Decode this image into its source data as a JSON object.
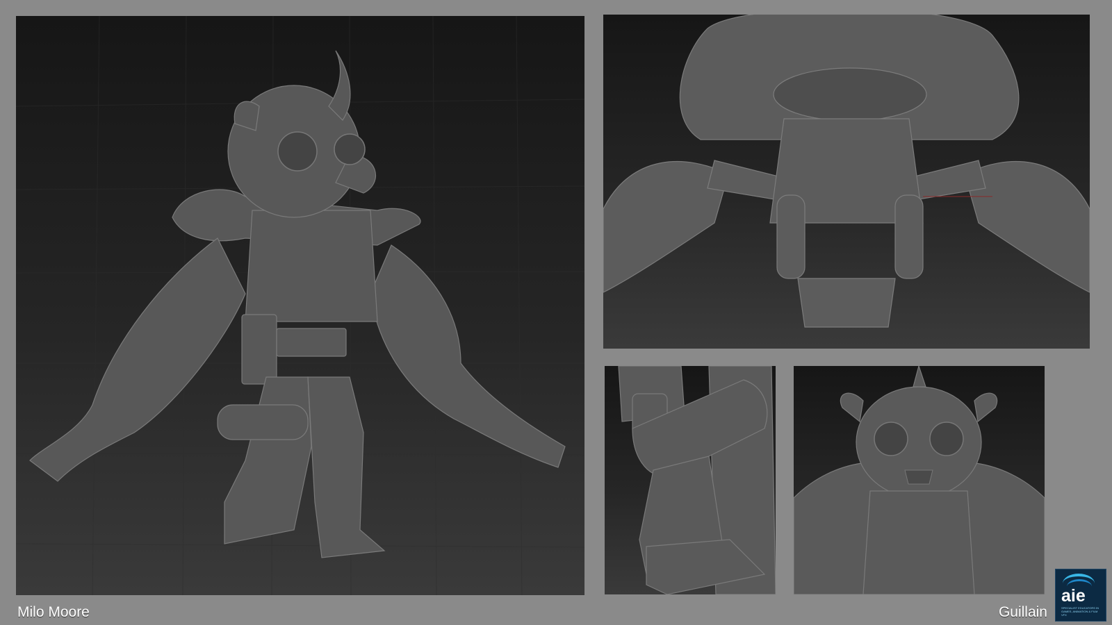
{
  "captions": {
    "artist": "Milo Moore",
    "subject": "Guillain"
  },
  "logo": {
    "wordmark": "aie",
    "tagline": "SPECIALIST EDUCATORS IN GAMES, ANIMATION & FILM VFX",
    "brand_color": "#0c2a43",
    "accent_color": "#39b7e6"
  },
  "panels": {
    "main": {
      "icon": "character-full-body-render"
    },
    "top": {
      "icon": "character-low-angle-render"
    },
    "leg": {
      "icon": "character-leg-detail-render"
    },
    "front": {
      "icon": "character-front-view-render"
    }
  },
  "colors": {
    "background": "#8a8a8a",
    "viewport": "#1f1f1f",
    "clay": "#5a5a5a"
  }
}
